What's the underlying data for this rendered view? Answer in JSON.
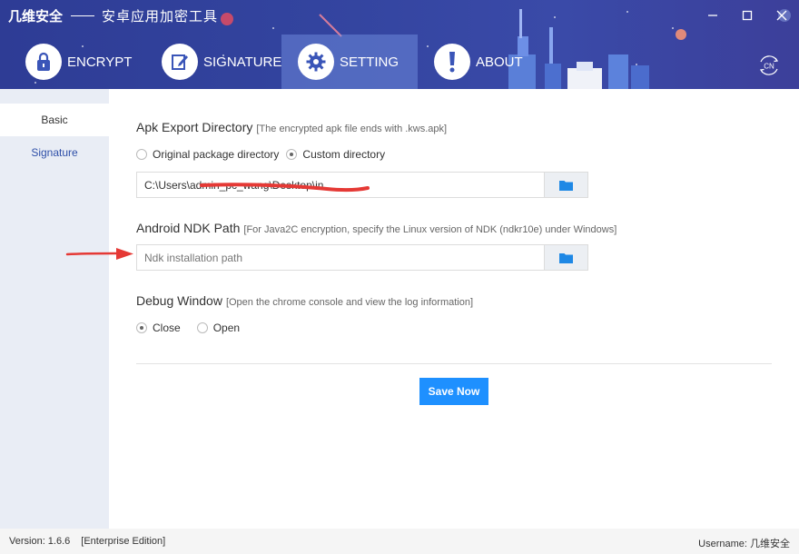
{
  "window": {
    "brand": "几维安全",
    "title": "安卓应用加密工具"
  },
  "tabs": [
    {
      "label": "ENCRYPT",
      "icon": "lock-icon"
    },
    {
      "label": "SIGNATURE",
      "icon": "edit-icon"
    },
    {
      "label": "SETTING",
      "icon": "gear-icon",
      "active": true
    },
    {
      "label": "ABOUT",
      "icon": "exclamation-icon"
    }
  ],
  "lang_button": {
    "label": "CN"
  },
  "sidebar": {
    "items": [
      {
        "label": "Basic",
        "active": true
      },
      {
        "label": "Signature",
        "active": false
      }
    ]
  },
  "apk_export": {
    "title": "Apk Export Directory",
    "hint": "[The encrypted apk file ends with .kws.apk]",
    "options": [
      {
        "label": "Original package directory",
        "checked": false
      },
      {
        "label": "Custom directory",
        "checked": true
      }
    ],
    "path_value": "C:\\Users\\admin_pc_wang\\Desktop\\in"
  },
  "ndk": {
    "title": "Android NDK Path",
    "hint": "[For Java2C encryption, specify the Linux version of NDK (ndkr10e) under Windows]",
    "placeholder": "Ndk installation path"
  },
  "debug": {
    "title": "Debug Window",
    "hint": "[Open the chrome console and view the log information]",
    "options": [
      {
        "label": "Close",
        "checked": true
      },
      {
        "label": "Open",
        "checked": false
      }
    ]
  },
  "save_button": {
    "label": "Save Now"
  },
  "footer": {
    "version": "Version:  1.6.6",
    "edition": "[Enterprise Edition]",
    "username": "Username:  几维安全"
  },
  "colors": {
    "header_bg": "#33449f",
    "accent": "#1e90ff",
    "sidebar_bg": "#e9edf5",
    "sidebar_link": "#2e4fa8",
    "folder_icon": "#1e88e5",
    "annotation": "#e53935"
  }
}
